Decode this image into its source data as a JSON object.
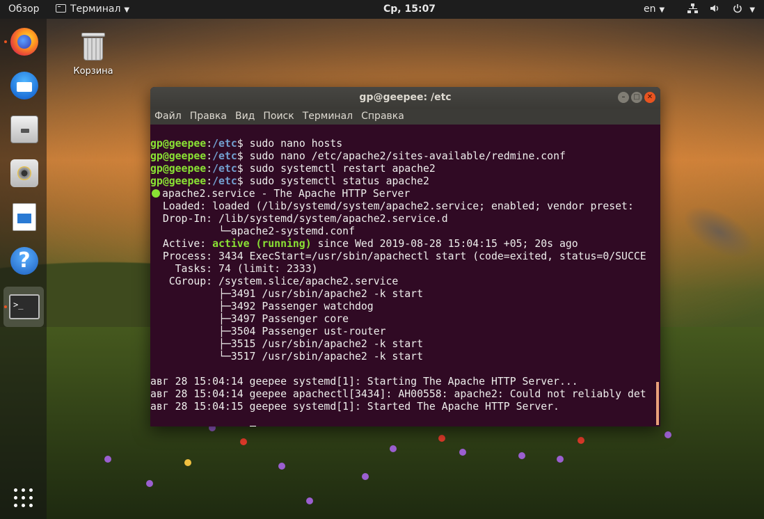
{
  "topbar": {
    "activities": "Обзор",
    "app_menu": "Терминал",
    "clock": "Ср, 15:07",
    "keyboard_layout": "en",
    "icons": [
      "network-icon",
      "volume-icon",
      "power-icon"
    ]
  },
  "dock": {
    "items": [
      {
        "name": "firefox-icon",
        "active": false
      },
      {
        "name": "thunderbird-icon",
        "active": false
      },
      {
        "name": "files-icon",
        "active": false
      },
      {
        "name": "rhythmbox-icon",
        "active": false
      },
      {
        "name": "libreoffice-writer-icon",
        "active": false
      },
      {
        "name": "help-icon",
        "active": false
      },
      {
        "name": "terminal-icon",
        "active": true
      }
    ],
    "show_apps_icon": "app-grid-icon"
  },
  "desktop": {
    "trash_label": "Корзина"
  },
  "window": {
    "title": "gp@geepee: /etc",
    "menu": [
      "Файл",
      "Правка",
      "Вид",
      "Поиск",
      "Терминал",
      "Справка"
    ]
  },
  "terminal": {
    "prompt_user": "gp@geepee",
    "prompt_path": "/etc",
    "commands": [
      "sudo nano hosts",
      "sudo nano /etc/apache2/sites-available/redmine.conf",
      "sudo systemctl restart apache2",
      "sudo systemctl status apache2"
    ],
    "status_header": "apache2.service - The Apache HTTP Server",
    "loaded": "  Loaded: loaded (/lib/systemd/system/apache2.service; enabled; vendor preset:",
    "dropin": "  Drop-In: /lib/systemd/system/apache2.service.d",
    "dropin_file": "           └─apache2-systemd.conf",
    "active_label": "  Active: ",
    "active_state": "active (running)",
    "active_rest": " since Wed 2019-08-28 15:04:15 +05; 20s ago",
    "process": "  Process: 3434 ExecStart=/usr/sbin/apachectl start (code=exited, status=0/SUCCE",
    "tasks": "    Tasks: 74 (limit: 2333)",
    "cgroup": "   CGroup: /system.slice/apache2.service",
    "cgroup_procs": [
      "           ├─3491 /usr/sbin/apache2 -k start",
      "           ├─3492 Passenger watchdog",
      "           ├─3497 Passenger core",
      "           ├─3504 Passenger ust-router",
      "           ├─3515 /usr/sbin/apache2 -k start",
      "           └─3517 /usr/sbin/apache2 -k start"
    ],
    "log": [
      "авг 28 15:04:14 geepee systemd[1]: Starting The Apache HTTP Server...",
      "авг 28 15:04:14 geepee apachectl[3434]: AH00558: apache2: Could not reliably det",
      "авг 28 15:04:15 geepee systemd[1]: Started The Apache HTTP Server."
    ]
  }
}
